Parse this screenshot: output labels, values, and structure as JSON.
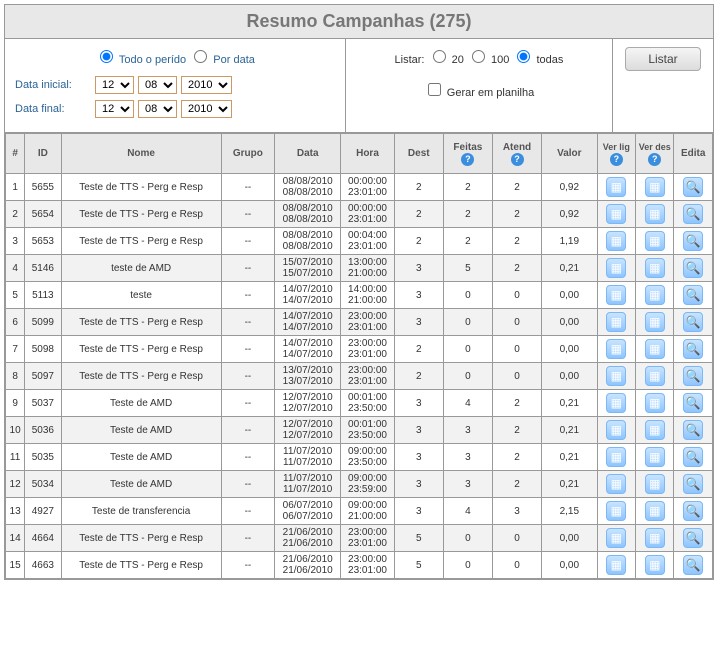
{
  "title": "Resumo Campanhas (275)",
  "period": {
    "opt_all": "Todo o perído",
    "opt_bydate": "Por data",
    "selected": "all",
    "start_label": "Data inicial:",
    "end_label": "Data final:",
    "start": {
      "d": "12",
      "m": "08",
      "y": "2010"
    },
    "end": {
      "d": "12",
      "m": "08",
      "y": "2010"
    }
  },
  "listing": {
    "label": "Listar:",
    "opt20": "20",
    "opt100": "100",
    "opt_all": "todas",
    "selected": "todas",
    "spreadsheet_label": "Gerar em planilha",
    "spreadsheet_checked": false
  },
  "button_list": "Listar",
  "headers": {
    "num": "#",
    "id": "ID",
    "nome": "Nome",
    "grupo": "Grupo",
    "data": "Data",
    "hora": "Hora",
    "dest": "Dest",
    "feitas": "Feitas",
    "atend": "Atend",
    "valor": "Valor",
    "verlig": "Ver lig",
    "verdes": "Ver des",
    "edita": "Edita"
  },
  "rows": [
    {
      "n": "1",
      "id": "5655",
      "nome": "Teste de TTS - Perg e Resp",
      "grupo": "--",
      "d1": "08/08/2010",
      "d2": "08/08/2010",
      "h1": "00:00:00",
      "h2": "23:01:00",
      "dest": "2",
      "feitas": "2",
      "atend": "2",
      "valor": "0,92"
    },
    {
      "n": "2",
      "id": "5654",
      "nome": "Teste de TTS - Perg e Resp",
      "grupo": "--",
      "d1": "08/08/2010",
      "d2": "08/08/2010",
      "h1": "00:00:00",
      "h2": "23:01:00",
      "dest": "2",
      "feitas": "2",
      "atend": "2",
      "valor": "0,92"
    },
    {
      "n": "3",
      "id": "5653",
      "nome": "Teste de TTS - Perg e Resp",
      "grupo": "--",
      "d1": "08/08/2010",
      "d2": "08/08/2010",
      "h1": "00:04:00",
      "h2": "23:01:00",
      "dest": "2",
      "feitas": "2",
      "atend": "2",
      "valor": "1,19"
    },
    {
      "n": "4",
      "id": "5146",
      "nome": "teste de AMD",
      "grupo": "--",
      "d1": "15/07/2010",
      "d2": "15/07/2010",
      "h1": "13:00:00",
      "h2": "21:00:00",
      "dest": "3",
      "feitas": "5",
      "atend": "2",
      "valor": "0,21"
    },
    {
      "n": "5",
      "id": "5113",
      "nome": "teste",
      "grupo": "--",
      "d1": "14/07/2010",
      "d2": "14/07/2010",
      "h1": "14:00:00",
      "h2": "21:00:00",
      "dest": "3",
      "feitas": "0",
      "atend": "0",
      "valor": "0,00"
    },
    {
      "n": "6",
      "id": "5099",
      "nome": "Teste de TTS - Perg e Resp",
      "grupo": "--",
      "d1": "14/07/2010",
      "d2": "14/07/2010",
      "h1": "23:00:00",
      "h2": "23:01:00",
      "dest": "3",
      "feitas": "0",
      "atend": "0",
      "valor": "0,00"
    },
    {
      "n": "7",
      "id": "5098",
      "nome": "Teste de TTS - Perg e Resp",
      "grupo": "--",
      "d1": "14/07/2010",
      "d2": "14/07/2010",
      "h1": "23:00:00",
      "h2": "23:01:00",
      "dest": "2",
      "feitas": "0",
      "atend": "0",
      "valor": "0,00"
    },
    {
      "n": "8",
      "id": "5097",
      "nome": "Teste de TTS - Perg e Resp",
      "grupo": "--",
      "d1": "13/07/2010",
      "d2": "13/07/2010",
      "h1": "23:00:00",
      "h2": "23:01:00",
      "dest": "2",
      "feitas": "0",
      "atend": "0",
      "valor": "0,00"
    },
    {
      "n": "9",
      "id": "5037",
      "nome": "Teste de AMD",
      "grupo": "--",
      "d1": "12/07/2010",
      "d2": "12/07/2010",
      "h1": "00:01:00",
      "h2": "23:50:00",
      "dest": "3",
      "feitas": "4",
      "atend": "2",
      "valor": "0,21"
    },
    {
      "n": "10",
      "id": "5036",
      "nome": "Teste de AMD",
      "grupo": "--",
      "d1": "12/07/2010",
      "d2": "12/07/2010",
      "h1": "00:01:00",
      "h2": "23:50:00",
      "dest": "3",
      "feitas": "3",
      "atend": "2",
      "valor": "0,21"
    },
    {
      "n": "11",
      "id": "5035",
      "nome": "Teste de AMD",
      "grupo": "--",
      "d1": "11/07/2010",
      "d2": "11/07/2010",
      "h1": "09:00:00",
      "h2": "23:50:00",
      "dest": "3",
      "feitas": "3",
      "atend": "2",
      "valor": "0,21"
    },
    {
      "n": "12",
      "id": "5034",
      "nome": "Teste de AMD",
      "grupo": "--",
      "d1": "11/07/2010",
      "d2": "11/07/2010",
      "h1": "09:00:00",
      "h2": "23:59:00",
      "dest": "3",
      "feitas": "3",
      "atend": "2",
      "valor": "0,21"
    },
    {
      "n": "13",
      "id": "4927",
      "nome": "Teste de transferencia",
      "grupo": "--",
      "d1": "06/07/2010",
      "d2": "06/07/2010",
      "h1": "09:00:00",
      "h2": "21:00:00",
      "dest": "3",
      "feitas": "4",
      "atend": "3",
      "valor": "2,15"
    },
    {
      "n": "14",
      "id": "4664",
      "nome": "Teste de TTS - Perg e Resp",
      "grupo": "--",
      "d1": "21/06/2010",
      "d2": "21/06/2010",
      "h1": "23:00:00",
      "h2": "23:01:00",
      "dest": "5",
      "feitas": "0",
      "atend": "0",
      "valor": "0,00"
    },
    {
      "n": "15",
      "id": "4663",
      "nome": "Teste de TTS - Perg e Resp",
      "grupo": "--",
      "d1": "21/06/2010",
      "d2": "21/06/2010",
      "h1": "23:00:00",
      "h2": "23:01:00",
      "dest": "5",
      "feitas": "0",
      "atend": "0",
      "valor": "0,00"
    }
  ]
}
